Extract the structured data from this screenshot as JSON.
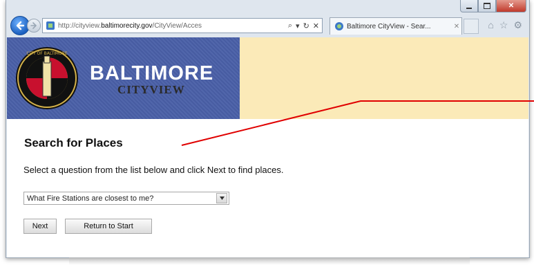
{
  "browser": {
    "address_url_prefix": "http://cityview.",
    "address_url_domain": "baltimorecity.gov",
    "address_url_path": "/CityView/Acces",
    "tab_title": "Baltimore CityView - Sear...",
    "icons": [
      "back-arrow-icon",
      "forward-arrow-icon",
      "search-icon",
      "compatibility-icon",
      "refresh-icon",
      "stop-icon",
      "home-icon",
      "favorites-star-icon",
      "gear-icon"
    ]
  },
  "banner": {
    "title": "BALTIMORE",
    "subtitle": "CITYVIEW",
    "seal_text": "CITY OF BALTIMORE",
    "colors": {
      "banner_blue": "#4a60a8",
      "banner_cream": "#fbeab8"
    }
  },
  "main": {
    "title": "Search for Places",
    "instructions": "Select a question from the list below and click Next to find places.",
    "question_select": {
      "selected": "What Fire Stations are closest to me?"
    },
    "next_label": "Next",
    "return_label": "Return to Start"
  },
  "annotation": {
    "line_color": "#e00000"
  }
}
